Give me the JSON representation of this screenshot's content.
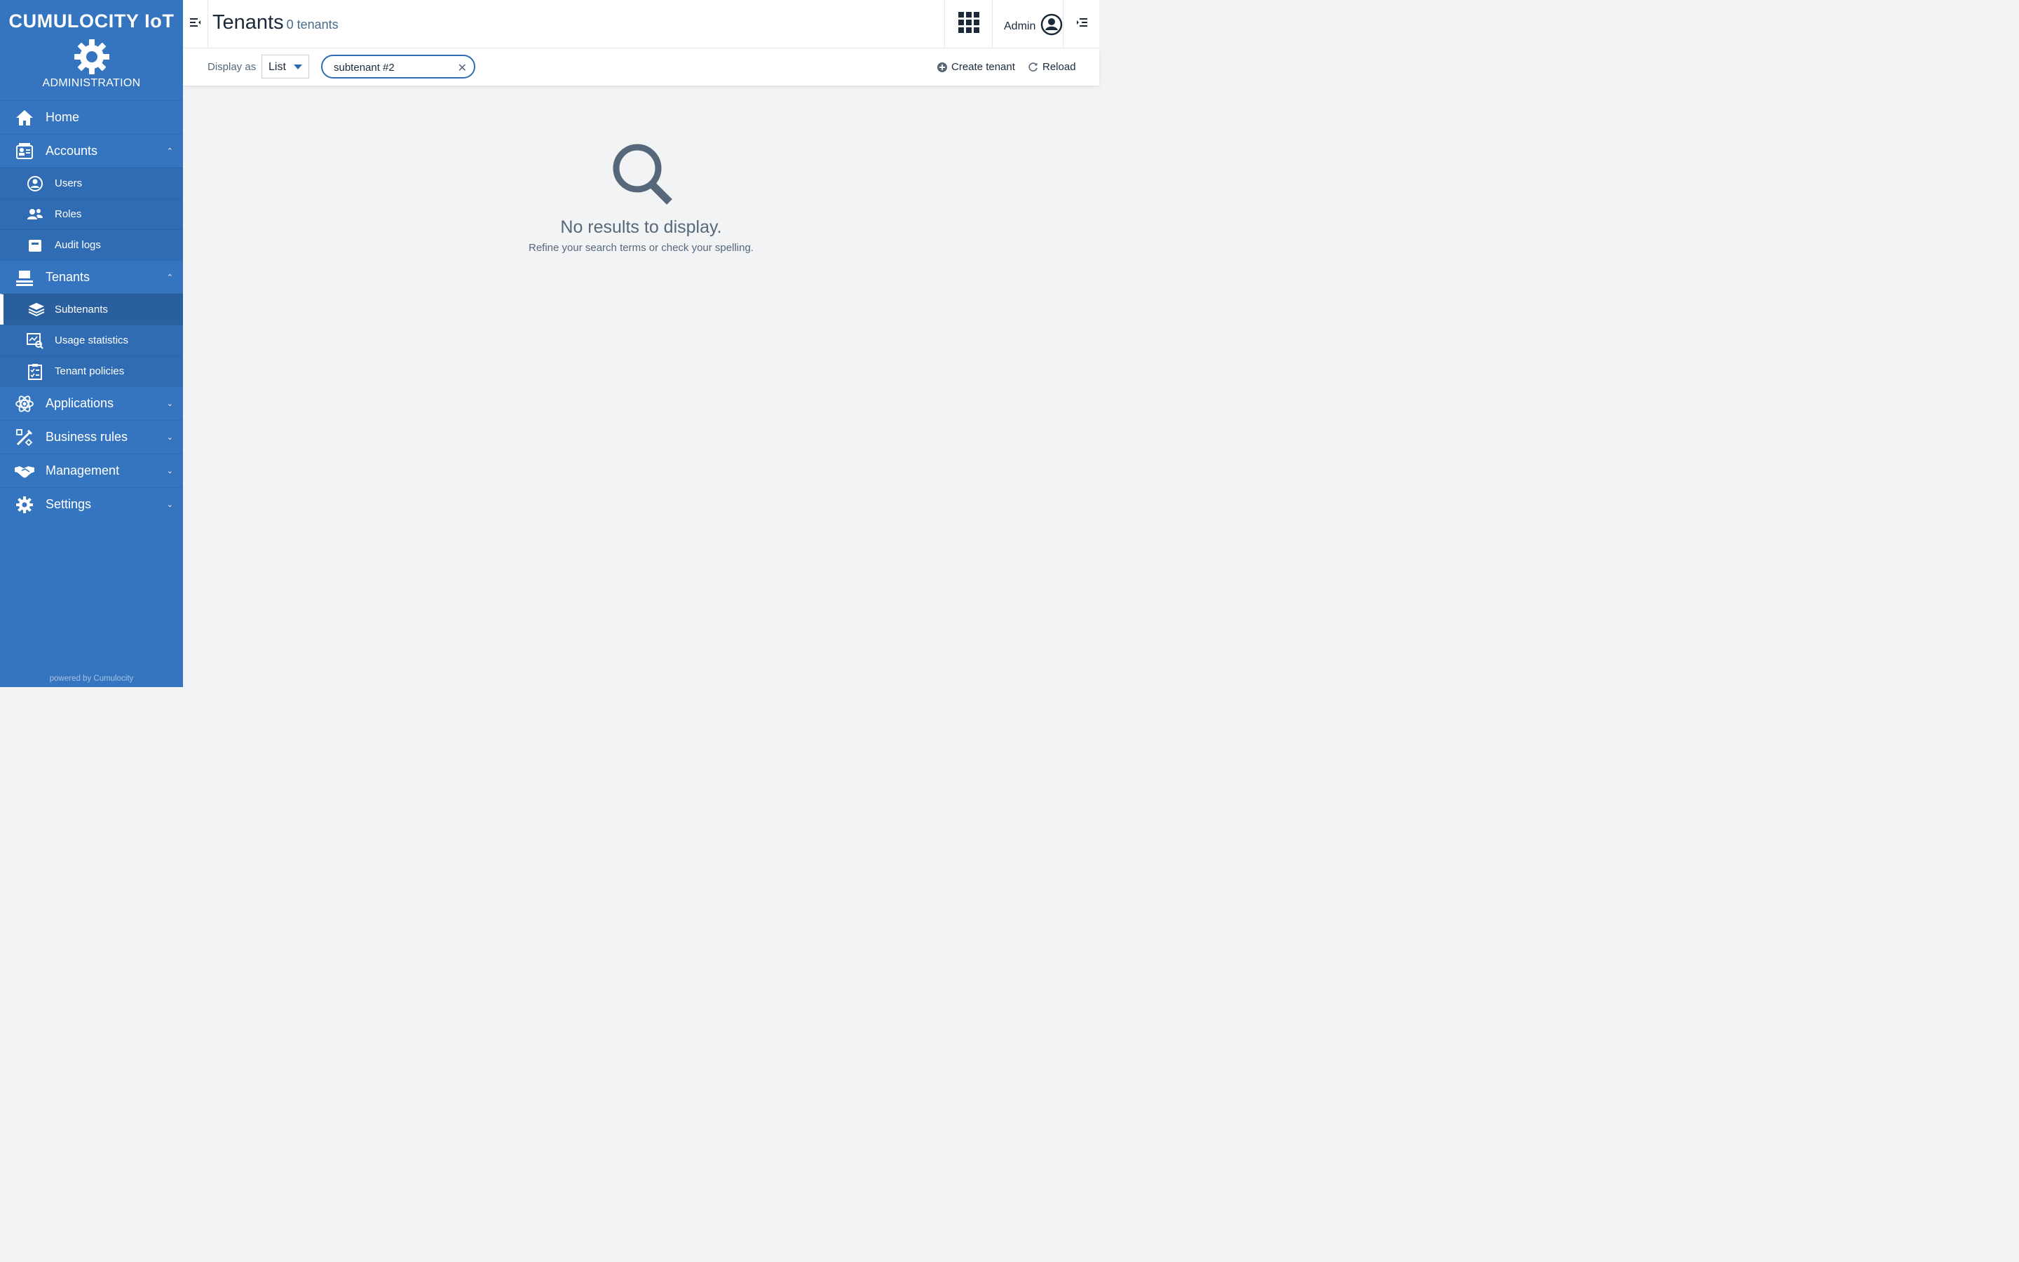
{
  "brand": {
    "title": "CUMULOCITY IoT",
    "subtitle": "ADMINISTRATION",
    "powered": "powered by Cumulocity"
  },
  "nav": {
    "home": "Home",
    "accounts": "Accounts",
    "users": "Users",
    "roles": "Roles",
    "audit_logs": "Audit logs",
    "tenants": "Tenants",
    "subtenants": "Subtenants",
    "usage_statistics": "Usage statistics",
    "tenant_policies": "Tenant policies",
    "applications": "Applications",
    "business_rules": "Business rules",
    "management": "Management",
    "settings": "Settings",
    "active_item": "Subtenants"
  },
  "header": {
    "title": "Tenants",
    "count": "0 tenants",
    "user": "Admin"
  },
  "toolbar": {
    "display_as_label": "Display as",
    "display_value": "List",
    "search_value": "subtenant #2",
    "create_label": "Create tenant",
    "reload_label": "Reload"
  },
  "empty": {
    "title": "No results to display.",
    "subtitle": "Refine your search terms or check your spelling."
  },
  "colors": {
    "sidebar": "#3575bf",
    "accent": "#2f6cb4",
    "icon_gray": "#56687a"
  }
}
